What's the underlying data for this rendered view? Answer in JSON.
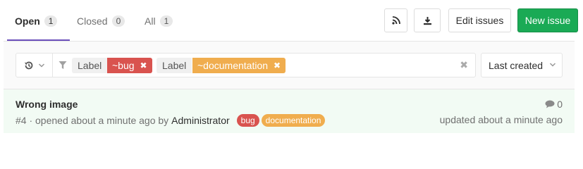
{
  "tabs": [
    {
      "label": "Open",
      "count": "1"
    },
    {
      "label": "Closed",
      "count": "0"
    },
    {
      "label": "All",
      "count": "1"
    }
  ],
  "toolbar": {
    "rss_icon": "rss-icon",
    "download_icon": "download-icon",
    "edit_label": "Edit issues",
    "new_label": "New issue",
    "new_color": "#1aaa55"
  },
  "filter": {
    "tokens": [
      {
        "name": "Label",
        "value": "~bug",
        "color": "#d9534f"
      },
      {
        "name": "Label",
        "value": "~documentation",
        "color": "#f0ad4e"
      }
    ],
    "sort_label": "Last created"
  },
  "issues": [
    {
      "title": "Wrong image",
      "meta": "#4 · opened about a minute ago by",
      "author": "Administrator",
      "labels": [
        "bug",
        "documentation"
      ],
      "comments": "0",
      "updated": "updated about a minute ago"
    }
  ]
}
